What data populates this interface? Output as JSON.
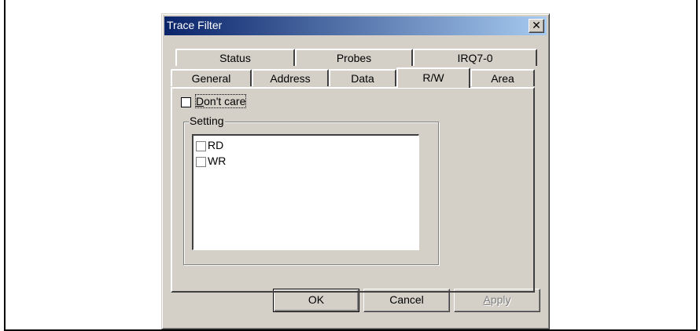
{
  "dialog": {
    "title": "Trace Filter",
    "close_glyph": "✕"
  },
  "tabs": {
    "row_back": [
      {
        "label": "Status"
      },
      {
        "label": "Probes"
      },
      {
        "label": "IRQ7-0"
      }
    ],
    "row_front": [
      {
        "label": "General"
      },
      {
        "label": "Address"
      },
      {
        "label": "Data"
      },
      {
        "label": "R/W",
        "selected": true
      },
      {
        "label": "Area"
      }
    ]
  },
  "panel": {
    "dont_care": {
      "label_first": "D",
      "label_rest": "on't care",
      "checked": false
    },
    "group_title": "Setting",
    "list_items": [
      {
        "label": "RD",
        "checked": false
      },
      {
        "label": "WR",
        "checked": false
      }
    ]
  },
  "buttons": {
    "ok": "OK",
    "cancel": "Cancel",
    "apply_first": "A",
    "apply_rest": "pply",
    "apply_disabled": true
  },
  "colors": {
    "title_gradient_start": "#0a246a",
    "title_gradient_end": "#a6caf0",
    "face": "#d4d0c8"
  },
  "icons": {
    "close": "close-icon"
  }
}
